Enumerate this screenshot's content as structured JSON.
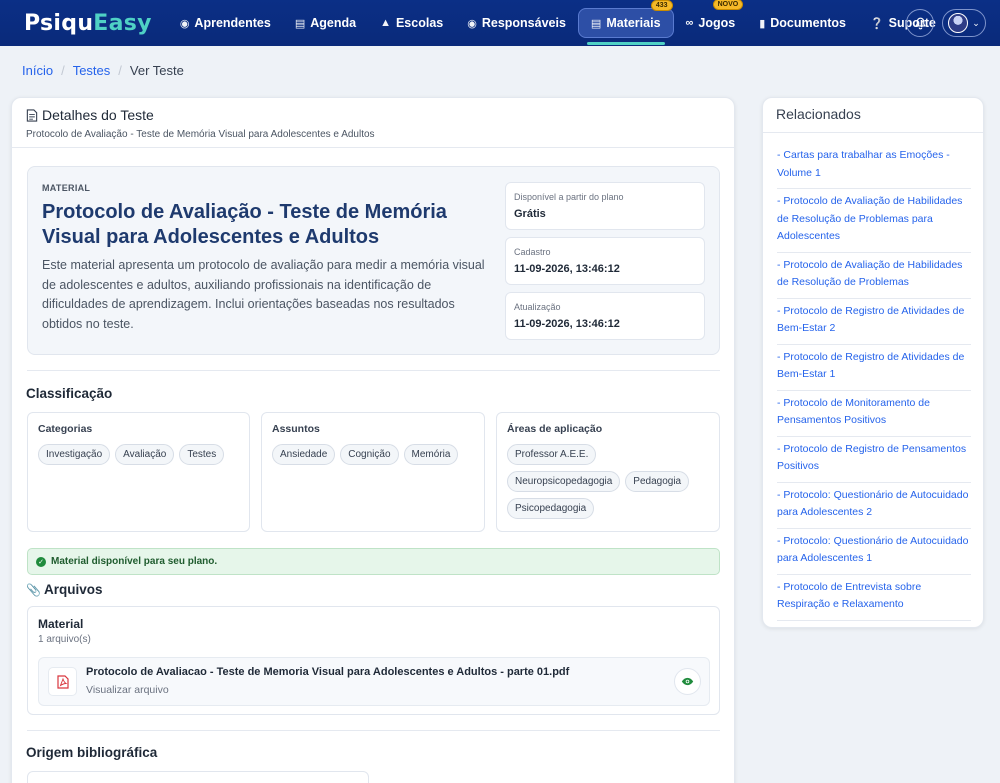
{
  "nav": {
    "logo_a": "Psiqu",
    "logo_b": "Easy",
    "items": [
      {
        "label": "Aprendentes",
        "icon": "users-icon"
      },
      {
        "label": "Agenda",
        "icon": "calendar-icon"
      },
      {
        "label": "Escolas",
        "icon": "graduation-cap-icon"
      },
      {
        "label": "Responsáveis",
        "icon": "user-circle-icon"
      },
      {
        "label": "Materiais",
        "icon": "file-icon",
        "badge": "433"
      },
      {
        "label": "Jogos",
        "icon": "gamepad-icon",
        "badge": "NOVO"
      },
      {
        "label": "Documentos",
        "icon": "book-icon"
      },
      {
        "label": "Suporte",
        "icon": "question-circle-icon"
      }
    ]
  },
  "breadcrumb": {
    "home": "Início",
    "section": "Testes",
    "current": "Ver Teste"
  },
  "detail": {
    "title": "Detalhes do Teste",
    "subtitle": "Protocolo de Avaliação - Teste de Memória Visual para Adolescentes e Adultos",
    "kicker": "MATERIAL",
    "heading": "Protocolo de Avaliação - Teste de Memória Visual para Adolescentes e Adultos",
    "description": "Este material apresenta um protocolo de avaliação para medir a memória visual de adolescentes e adultos, auxiliando profissionais na identificação de dificuldades de aprendizagem. Inclui orientações baseadas nos resultados obtidos no teste.",
    "meta": [
      {
        "label": "Disponível a partir do plano",
        "value": "Grátis"
      },
      {
        "label": "Cadastro",
        "value": "11-09-2026, 13:46:12"
      },
      {
        "label": "Atualização",
        "value": "11-09-2026, 13:46:12"
      }
    ]
  },
  "classification": {
    "title": "Classificação",
    "categories": {
      "label": "Categorias",
      "chips": [
        "Investigação",
        "Avaliação",
        "Testes"
      ]
    },
    "subjects": {
      "label": "Assuntos",
      "chips": [
        "Ansiedade",
        "Cognição",
        "Memória"
      ]
    },
    "areas": {
      "label": "Áreas de aplicação",
      "chips": [
        "Professor A.E.E.",
        "Neuropsicopedagogia",
        "Pedagogia",
        "Psicopedagogia"
      ]
    }
  },
  "alert": {
    "text": "Material disponível para seu plano."
  },
  "files": {
    "title": "Arquivos",
    "group_title": "Material",
    "count": "1 arquivo(s)",
    "file_name": "Protocolo de Avaliacao - Teste de Memoria Visual para Adolescentes e Adultos - parte 01.pdf",
    "file_action": "Visualizar arquivo"
  },
  "biblio": {
    "title": "Origem bibliográfica"
  },
  "related": {
    "title": "Relacionados",
    "items": [
      "- Cartas para trabalhar as Emoções - Volume 1",
      "- Protocolo de Avaliação de Habilidades de Resolução de Problemas para Adolescentes",
      "- Protocolo de Avaliação de Habilidades de Resolução de Problemas",
      "- Protocolo de Registro de Atividades de Bem-Estar 2",
      "- Protocolo de Registro de Atividades de Bem-Estar 1",
      "- Protocolo de Monitoramento de Pensamentos Positivos",
      "- Protocolo de Registro de Pensamentos Positivos",
      "- Protocolo: Questionário de Autocuidado para Adolescentes 2",
      "- Protocolo: Questionário de Autocuidado para Adolescentes 1",
      "- Protocolo de Entrevista sobre Respiração e Relaxamento"
    ]
  },
  "colors": {
    "nav_bg": "#0a2a7a",
    "accent": "#4fd1c5",
    "link": "#2563eb",
    "success": "#1f8b3c",
    "badge": "#f5b928"
  }
}
